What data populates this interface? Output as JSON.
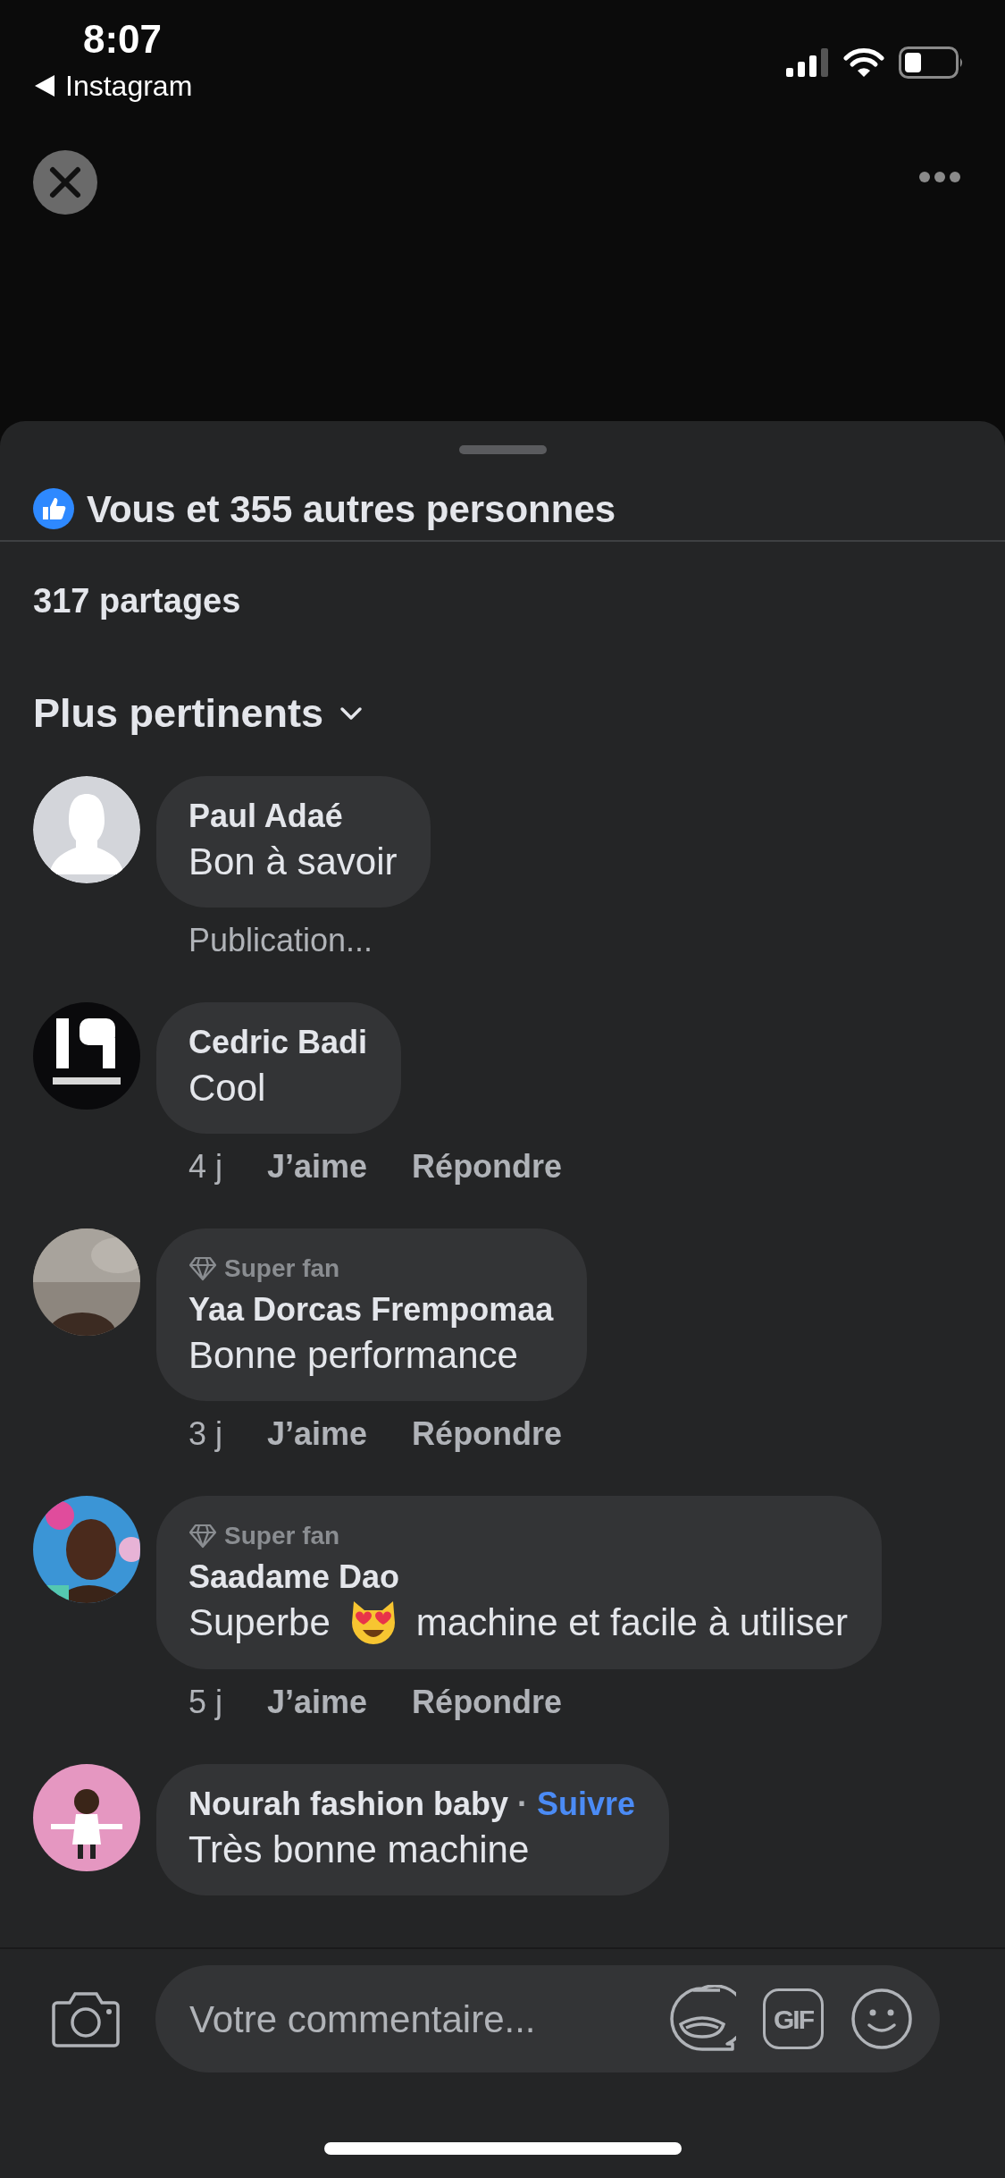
{
  "status_bar": {
    "time": "8:07",
    "back_app": "Instagram"
  },
  "reactions": {
    "text": "Vous et 355 autres personnes"
  },
  "shares": "317 partages",
  "sort": {
    "label": "Plus pertinents"
  },
  "comments": [
    {
      "kind": "default_avatar",
      "name": "Paul Adaé",
      "text": "Bon à savoir",
      "status": "Publication..."
    },
    {
      "kind": "picture",
      "name": "Cedric Badi",
      "text": "Cool",
      "meta": {
        "time": "4 j",
        "like": "J’aime",
        "reply": "Répondre"
      }
    },
    {
      "kind": "picture",
      "badge": "Super fan",
      "name": "Yaa Dorcas Frempomaa",
      "text": "Bonne performance",
      "meta": {
        "time": "3 j",
        "like": "J’aime",
        "reply": "Répondre"
      }
    },
    {
      "kind": "picture",
      "badge": "Super fan",
      "name": "Saadame Dao",
      "text": "Superbe",
      "text_after_emoji": "machine et facile à utiliser",
      "meta": {
        "time": "5 j",
        "like": "J’aime",
        "reply": "Répondre"
      }
    },
    {
      "kind": "picture",
      "name": "Nourah fashion baby",
      "separator": "·",
      "follow": "Suivre",
      "text": "Très bonne machine"
    }
  ],
  "composer": {
    "placeholder": "Votre commentaire...",
    "gif_label": "GIF"
  }
}
